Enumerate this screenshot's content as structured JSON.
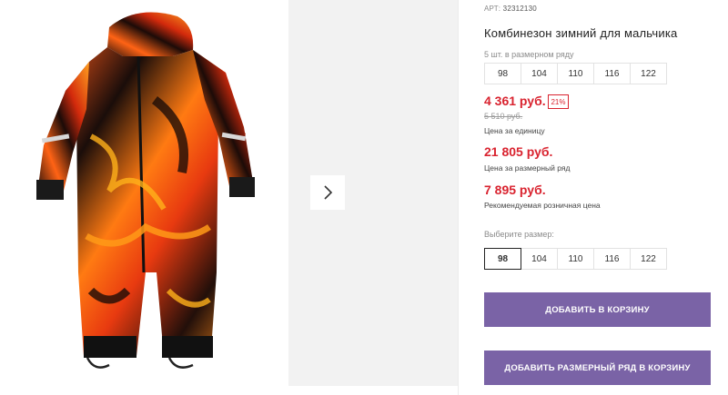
{
  "product": {
    "article_label": "АРТ:",
    "article_number": "32312130",
    "title": "Комбинезон зимний для мальчика"
  },
  "pack": {
    "label": "5 шт. в размерном ряду",
    "sizes": [
      "98",
      "104",
      "110",
      "116",
      "122"
    ]
  },
  "prices": {
    "unit_price": "4 361 руб.",
    "discount_badge": "21%",
    "old_price": "5 510 руб.",
    "unit_caption": "Цена за единицу",
    "pack_price": "21 805 руб.",
    "pack_caption": "Цена за размерный ряд",
    "retail_price": "7 895 руб.",
    "retail_caption": "Рекомендуемая розничная цена"
  },
  "size_picker": {
    "label": "Выберите размер:",
    "sizes": [
      "98",
      "104",
      "110",
      "116",
      "122"
    ],
    "selected": "98"
  },
  "buttons": {
    "add_to_cart": "ДОБАВИТЬ В КОРЗИНУ",
    "add_pack_to_cart": "ДОБАВИТЬ РАЗМЕРНЫЙ РЯД В КОРЗИНУ"
  },
  "colors": {
    "price_red": "#d9232f",
    "button_purple": "#7a63a6"
  },
  "icons": {
    "gallery_next": "chevron-right-icon"
  }
}
